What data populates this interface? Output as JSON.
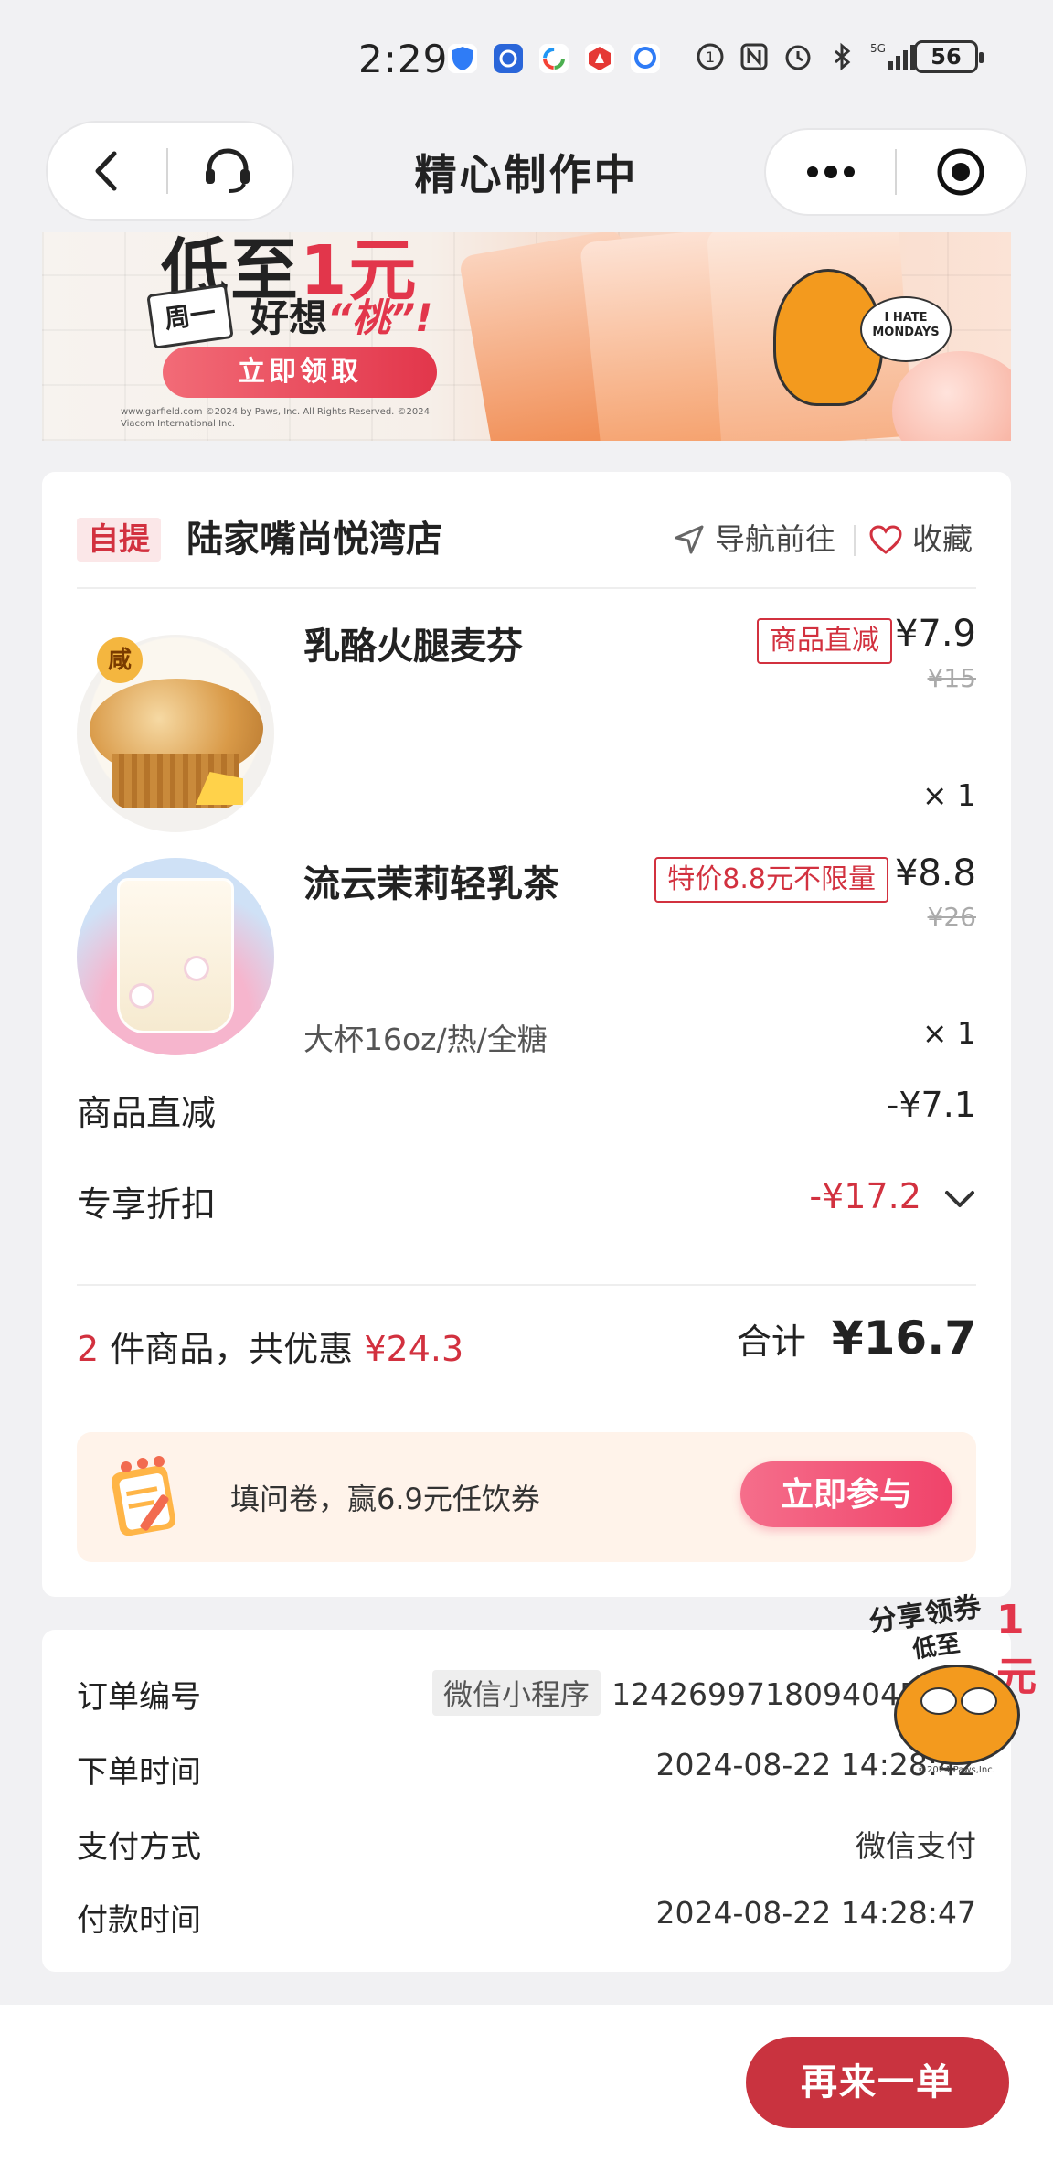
{
  "status_bar": {
    "time": "2:29",
    "network": "5G",
    "battery": "56"
  },
  "nav": {
    "title": "精心制作中"
  },
  "banner": {
    "headline_prefix": "低至",
    "headline_suffix": "1元",
    "day": "周一",
    "sub_prefix": "好想",
    "sub_highlight": "“桃”!",
    "cta": "立即领取",
    "bubble": "I HATE MONDAYS",
    "copyright": "www.garfield.com ©2024 by Paws, Inc. All Rights Reserved. ©2024 Viacom International Inc."
  },
  "store": {
    "pickup_label": "自提",
    "name": "陆家嘴尚悦湾店",
    "navigate_label": "导航前往",
    "favorite_label": "收藏"
  },
  "items": [
    {
      "name": "乳酪火腿麦芬",
      "promo": "商品直减",
      "price": "¥7.9",
      "original_price": "¥15",
      "spec": "",
      "qty": "× 1",
      "flavor_tag": "咸"
    },
    {
      "name": "流云茉莉轻乳茶",
      "promo": "特价8.8元不限量",
      "price": "¥8.8",
      "original_price": "¥26",
      "spec": "大杯16oz/热/全糖",
      "qty": "× 1"
    }
  ],
  "discounts": {
    "direct_label": "商品直减",
    "direct_value": "-¥7.1",
    "exclusive_label": "专享折扣",
    "exclusive_value": "-¥17.2"
  },
  "summary": {
    "count": "2",
    "count_text": " 件商品，共优惠 ",
    "saved": "¥24.3",
    "total_label": "合计",
    "total": "¥16.7"
  },
  "survey": {
    "text": "填问卷，赢6.9元任饮券",
    "button": "立即参与"
  },
  "order_info": {
    "order_no_label": "订单编号",
    "source": "微信小程序",
    "order_no": "12426997180940451",
    "order_time_label": "下单时间",
    "order_time": "2024-08-22 14:28:42",
    "payment_label": "支付方式",
    "payment": "微信支付",
    "paid_time_label": "付款时间",
    "paid_time": "2024-08-22 14:28:47"
  },
  "share_float": {
    "line1": "分享领券",
    "line2": "低至",
    "highlight": "1元",
    "copyright": "©2024 Paws,Inc."
  },
  "bottom": {
    "reorder": "再来一单"
  },
  "colors": {
    "brand_red": "#c9333f",
    "price_red": "#d2313f",
    "page_bg": "#f1f1f3"
  }
}
